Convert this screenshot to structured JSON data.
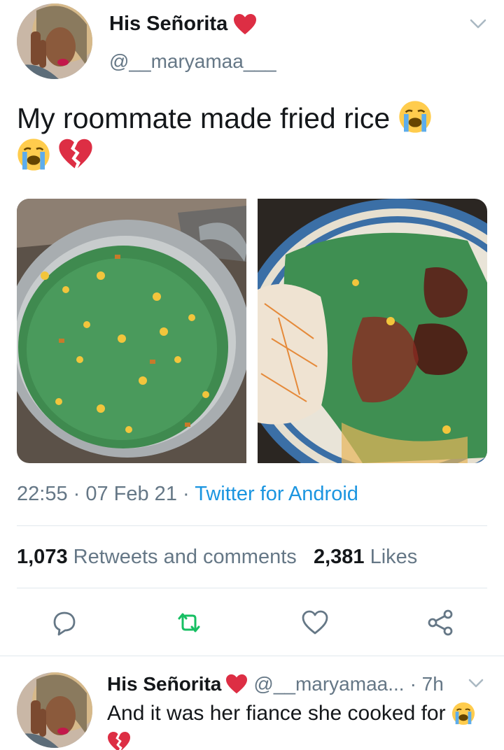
{
  "tweet": {
    "display_name": "His Señorita",
    "handle": "@__maryamaa___",
    "text": "My roommate made fried rice",
    "timestamp": "22:55 · 07 Feb 21 · ",
    "source": "Twitter for Android",
    "stats": {
      "retweets_count": "1,073",
      "retweets_label": "Retweets and comments",
      "likes_count": "2,381",
      "likes_label": "Likes"
    }
  },
  "reply": {
    "display_name": "His Señorita",
    "handle": "@__maryamaa...",
    "time": "· 7h",
    "text": "And it was her fiance she cooked for"
  },
  "icons": {
    "emoji_heart": "red-heart-icon",
    "emoji_crying": "loudly-crying-face-icon",
    "emoji_broken": "broken-heart-icon",
    "actions": [
      "reply-icon",
      "retweet-icon",
      "like-icon",
      "share-icon"
    ]
  },
  "colors": {
    "accent": "#1b95e0",
    "secondary_text": "#657786",
    "retweet_green": "#17bf63",
    "divider": "#e1e8ed"
  }
}
